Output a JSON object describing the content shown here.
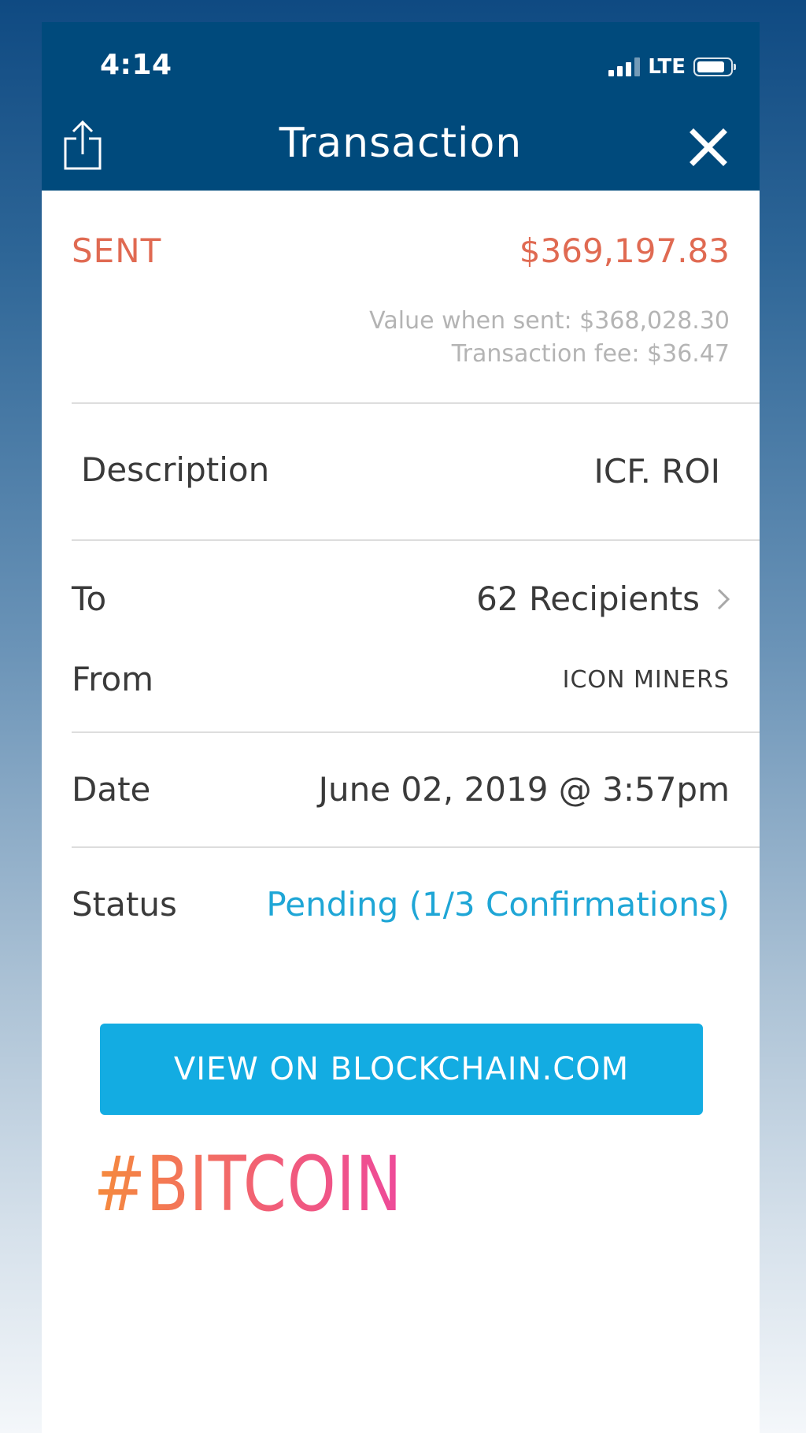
{
  "status_bar": {
    "time": "4:14",
    "network": "LTE"
  },
  "header": {
    "title": "Transaction",
    "icons": [
      "share-icon",
      "close-icon"
    ]
  },
  "summary": {
    "direction": "SENT",
    "amount": "$369,197.83",
    "value_when_sent": "Value when sent: $368,028.30",
    "transaction_fee": "Transaction fee: $36.47"
  },
  "details": {
    "description_label": "Description",
    "description_value": "ICF. ROI",
    "to_label": "To",
    "to_value": "62 Recipients",
    "from_label": "From",
    "from_value": "ICON MINERS",
    "date_label": "Date",
    "date_value": "June 02, 2019 @ 3:57pm",
    "status_label": "Status",
    "status_value": "Pending (1/3 Confirmations)"
  },
  "actions": {
    "view_button": "VIEW ON BLOCKCHAIN.COM"
  },
  "overlay": {
    "hashtag": "#BITCOIN"
  },
  "colors": {
    "header_bg": "#004a7c",
    "sent": "#e06a52",
    "status": "#1fa6d6",
    "button": "#13ace2"
  }
}
